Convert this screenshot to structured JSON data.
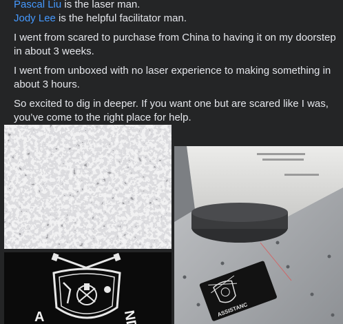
{
  "post": {
    "mention1": {
      "name": "Pascal Liu",
      "text": " is the laser man."
    },
    "mention2": {
      "name": "Jody Lee",
      "text": " is the helpful facilitator man."
    },
    "paragraphs": [
      "I went from scared to purchase from China to having it on my doorstep in about 3 weeks.",
      "I went from unboxed with no laser experience to making something in about 3 hours.",
      "So excited to dig in deeper. If you want one but are scared like I was, you’ve come to the right place for help."
    ]
  },
  "photos": {
    "granite": {
      "alt": "granite-photo"
    },
    "card": {
      "alt": "engraved-card-photo",
      "engraving_letters": [
        "A",
        "ND"
      ]
    },
    "machine": {
      "alt": "fiber-laser-machine-photo",
      "card_text": "ASSISTANC"
    }
  },
  "colors": {
    "background": "#242526",
    "text": "#e4e6eb",
    "mention": "#4599ff"
  }
}
